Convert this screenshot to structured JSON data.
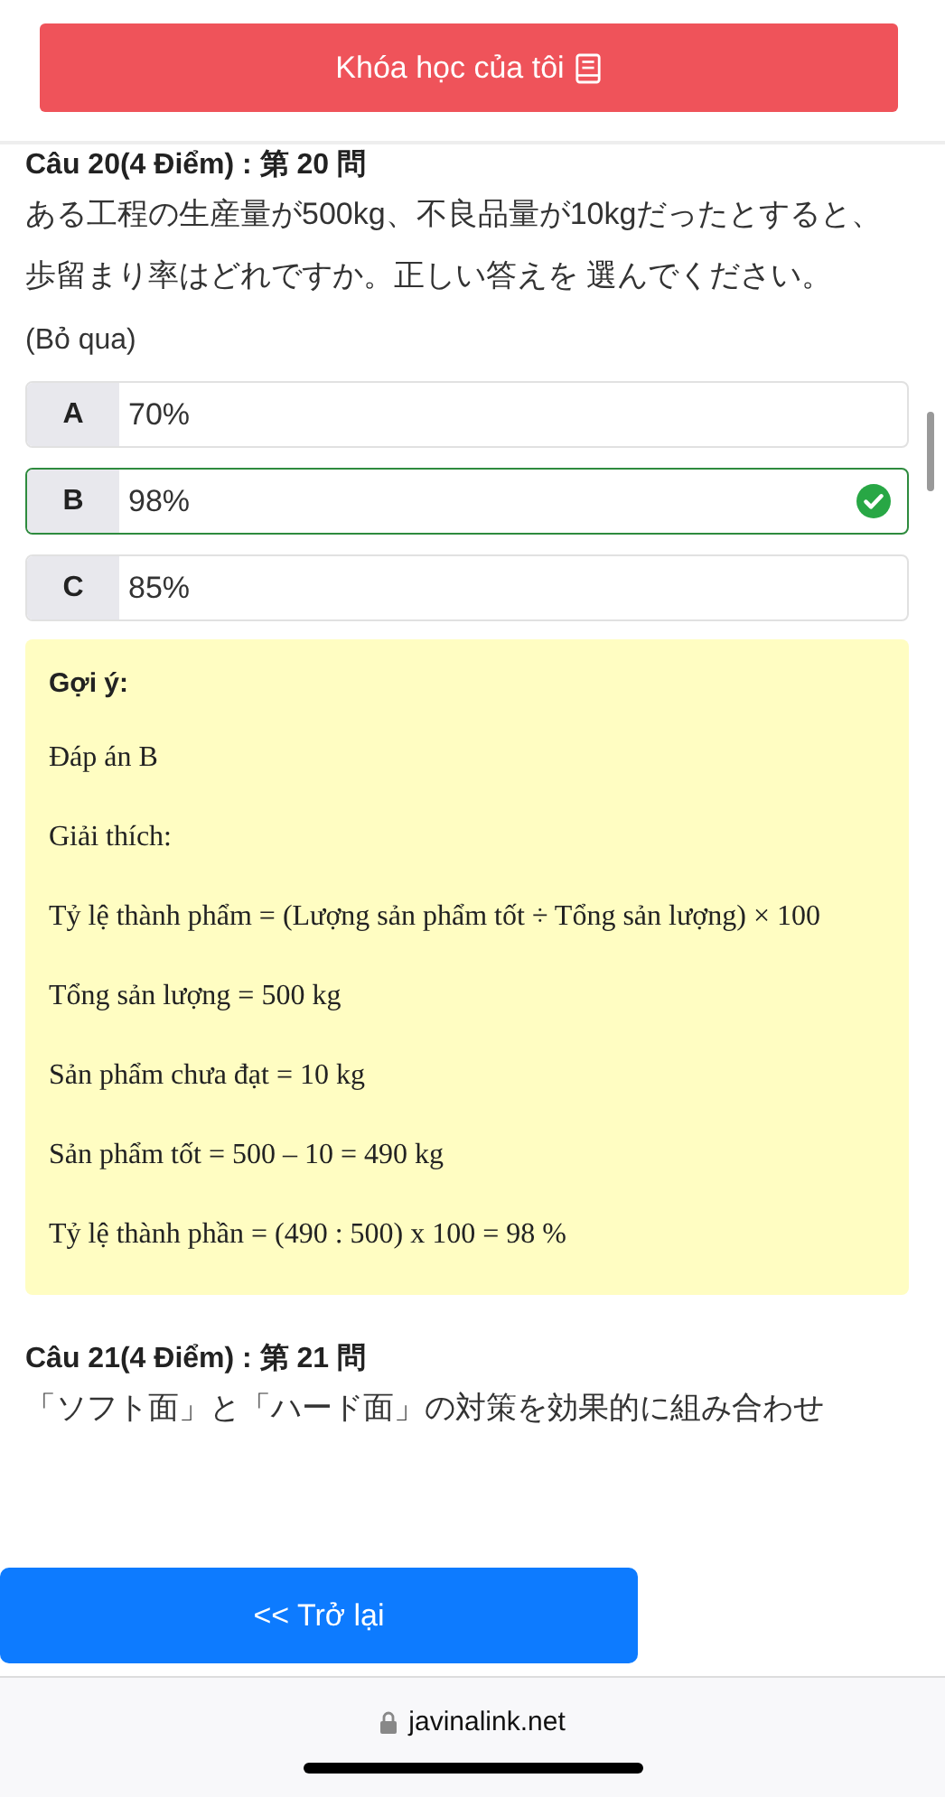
{
  "header_button": {
    "label": "Khóa học của tôi"
  },
  "questions": [
    {
      "title": "Câu 20(4 Điểm) : 第 20 問",
      "text": "ある工程の生産量が500kg、不良品量が10kgだったとすると、歩留まり率はどれですか。正しい答えを 選んでください。",
      "skip": "(Bỏ qua)",
      "options": [
        {
          "letter": "A",
          "text": "70%",
          "correct": false
        },
        {
          "letter": "B",
          "text": "98%",
          "correct": true
        },
        {
          "letter": "C",
          "text": "85%",
          "correct": false
        }
      ],
      "hint": {
        "title": "Gợi ý:",
        "lines": [
          "Đáp án B",
          "Giải thích:",
          "Tỷ lệ thành phẩm = (Lượng sản phẩm tốt ÷ Tổng sản lượng) × 100",
          "Tổng sản lượng = 500 kg",
          "Sản phẩm chưa đạt = 10 kg",
          "Sản phẩm tốt = 500 – 10  = 490 kg",
          "Tỷ lệ thành phần = (490 : 500) x 100 = 98 %"
        ]
      }
    },
    {
      "title": "Câu 21(4 Điểm) : 第 21 問",
      "text": "「ソフト面」と「ハード面」の対策を効果的に組み合わせ"
    }
  ],
  "back_button": {
    "label": "<< Trở lại"
  },
  "browser_bar": {
    "url": "javinalink.net"
  }
}
